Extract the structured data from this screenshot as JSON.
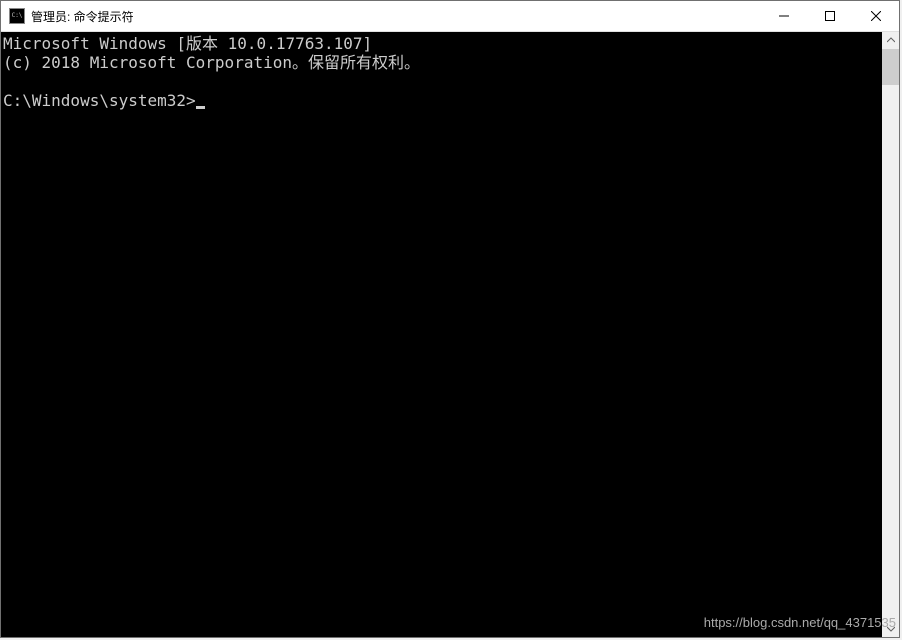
{
  "titlebar": {
    "title": "管理员: 命令提示符",
    "icon_label": "C:\\"
  },
  "console": {
    "line1": "Microsoft Windows [版本 10.0.17763.107]",
    "line2": "(c) 2018 Microsoft Corporation。保留所有权利。",
    "prompt": "C:\\Windows\\system32>"
  },
  "watermark": "https://blog.csdn.net/qq_4371535"
}
